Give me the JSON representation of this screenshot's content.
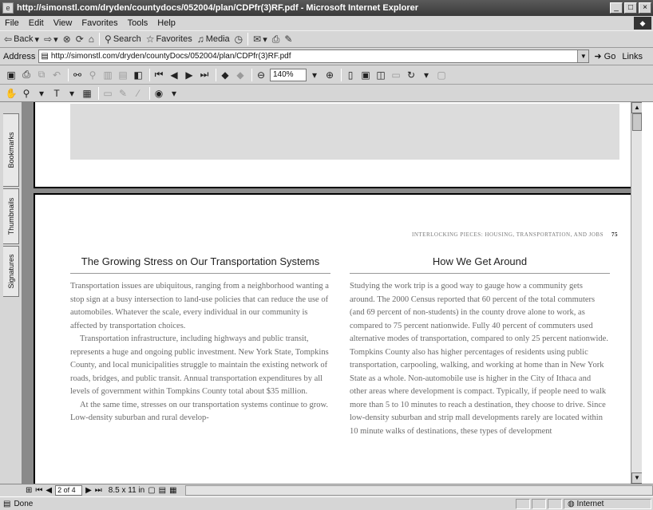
{
  "window": {
    "title": "http://simonstl.com/dryden/countydocs/052004/plan/CDPfr(3)RF.pdf - Microsoft Internet Explorer",
    "controls": [
      "_",
      "□",
      "×"
    ]
  },
  "menu": {
    "items": [
      "File",
      "Edit",
      "View",
      "Favorites",
      "Tools",
      "Help"
    ]
  },
  "toolbar": {
    "back_label": "Back",
    "search_label": "Search",
    "favorites_label": "Favorites",
    "media_label": "Media"
  },
  "address": {
    "label": "Address",
    "url": "http://simonstl.com/dryden/countyDocs/052004/plan/CDPfr(3)RF.pdf",
    "go_label": "Go",
    "links_label": "Links"
  },
  "acrobat": {
    "zoom": "140%"
  },
  "sidebar": {
    "tabs": [
      "Bookmarks",
      "Thumbnails",
      "Signatures"
    ]
  },
  "document": {
    "running_head": "Interlocking Pieces: Housing, Transportation, and Jobs",
    "page_number": "75",
    "left": {
      "heading": "The Growing Stress on Our Transportation Systems",
      "paragraphs": [
        "Transportation issues are ubiquitous, ranging from a neighborhood wanting a stop sign at a busy intersection to land-use policies that can reduce the use of automobiles. Whatever the scale, every individual in our community is affected by transportation choices.",
        "Transportation infrastructure, including highways and public transit, represents a huge and ongoing public investment. New York State, Tompkins County, and local municipalities struggle to maintain the existing network of roads, bridges, and public transit. Annual transportation expenditures by all levels of government within Tompkins County total about $35 million.",
        "At the same time, stresses on our transportation systems continue to grow. Low-density suburban and rural develop-"
      ]
    },
    "right": {
      "heading": "How We Get Around",
      "paragraphs": [
        "Studying the work trip is a good way to gauge how a community gets around. The 2000 Census reported that 60 percent of the total commuters (and 69 percent of non-students) in the county drove alone to work, as compared to 75 percent nationwide. Fully 40 percent of commuters used alternative modes of transportation, compared to only 25 percent nationwide. Tompkins County also has higher percentages of residents using public transportation, carpooling, walking, and working at home than in New York State as a whole. Non-automobile use is higher in the City of Ithaca and other areas where development is compact. Typically, if people need to walk more than 5 to 10 minutes to reach a destination, they choose to drive. Since low-density suburban and strip mall developments rarely are located within 10 minute walks of destinations, these types of development"
      ]
    }
  },
  "acrobat_status": {
    "page_indicator": "2 of 4",
    "page_size": "8.5 x 11 in"
  },
  "status": {
    "text": "Done",
    "zone": "Internet"
  }
}
